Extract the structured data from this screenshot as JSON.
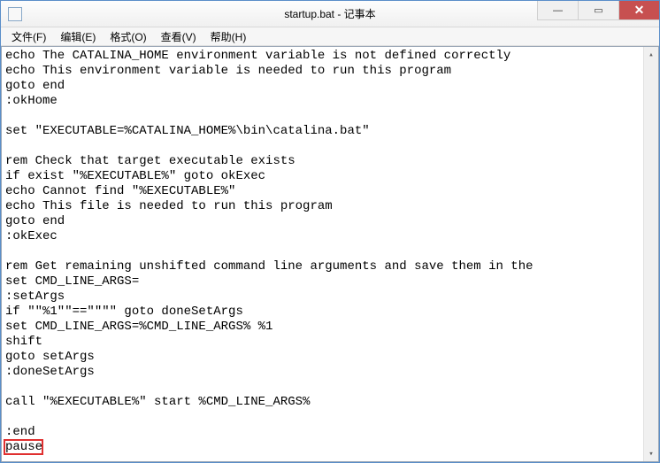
{
  "window": {
    "title": "startup.bat - 记事本"
  },
  "menu": {
    "file": "文件(F)",
    "edit": "编辑(E)",
    "format": "格式(O)",
    "view": "查看(V)",
    "help": "帮助(H)"
  },
  "win_controls": {
    "min": "—",
    "max": "▭",
    "close": "✕"
  },
  "scroll": {
    "up": "▴",
    "down": "▾"
  },
  "content": "echo The CATALINA_HOME environment variable is not defined correctly\necho This environment variable is needed to run this program\ngoto end\n:okHome\n\nset \"EXECUTABLE=%CATALINA_HOME%\\bin\\catalina.bat\"\n\nrem Check that target executable exists\nif exist \"%EXECUTABLE%\" goto okExec\necho Cannot find \"%EXECUTABLE%\"\necho This file is needed to run this program\ngoto end\n:okExec\n\nrem Get remaining unshifted command line arguments and save them in the\nset CMD_LINE_ARGS=\n:setArgs\nif \"\"%1\"\"==\"\"\"\" goto doneSetArgs\nset CMD_LINE_ARGS=%CMD_LINE_ARGS% %1\nshift\ngoto setArgs\n:doneSetArgs\n\ncall \"%EXECUTABLE%\" start %CMD_LINE_ARGS%\n\n:end\npause",
  "highlight": {
    "target_line": "pause"
  }
}
